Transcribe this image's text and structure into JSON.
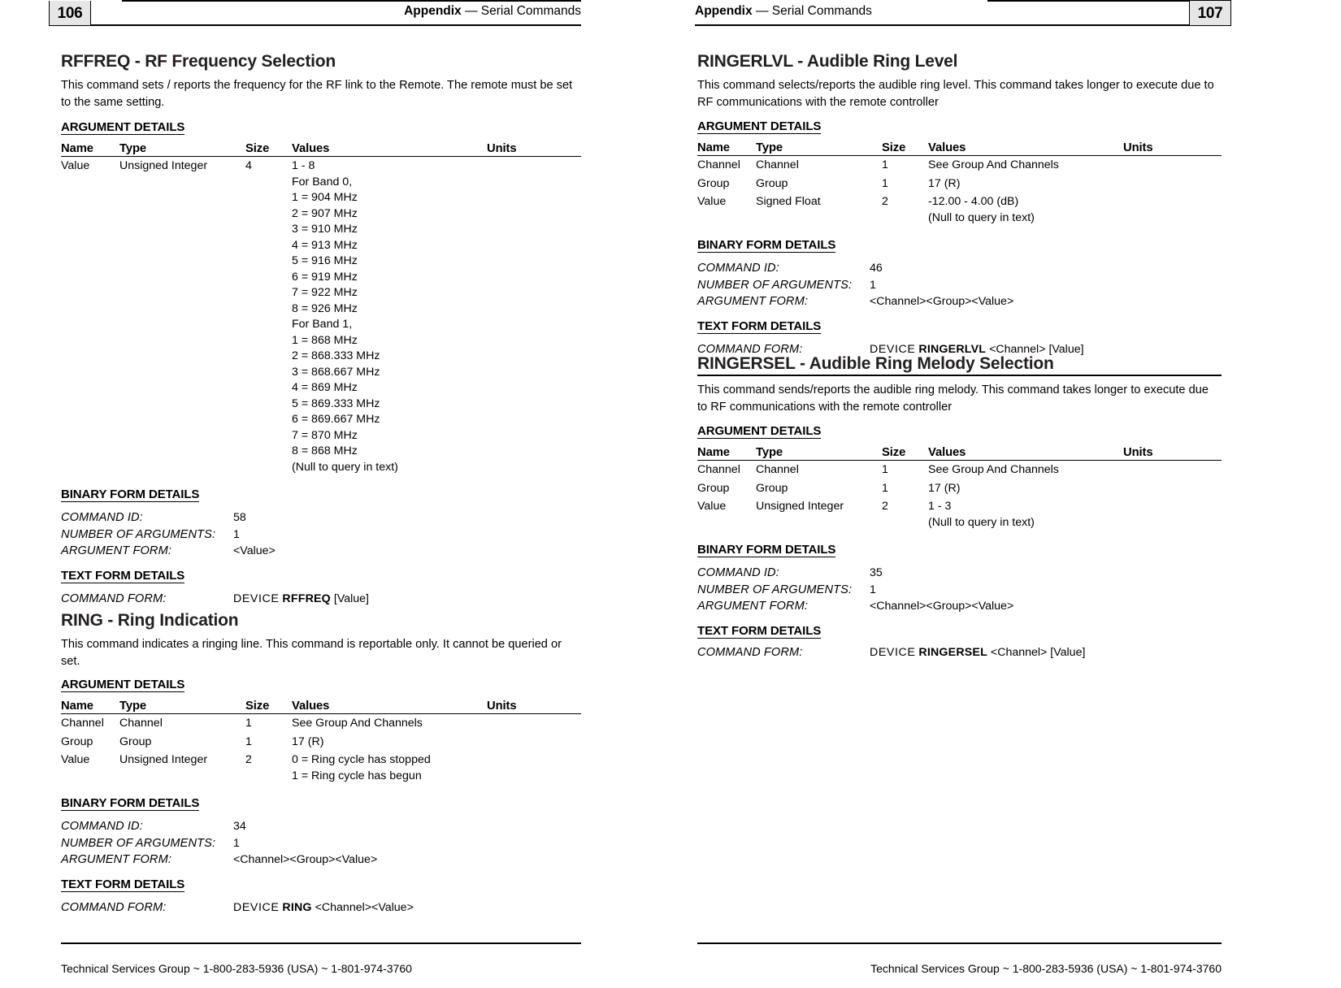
{
  "spread": {
    "left_page": {
      "page_number": "106",
      "header_title_bold": "Appendix",
      "header_title_rest": "— Serial Commands",
      "footer": "Technical Services Group ~ 1-800-283-5936 (USA) ~ 1-801-974-3760",
      "sections": [
        {
          "heading": "RFFREQ - RF Frequency Selection",
          "description": "This command sets / reports the frequency for the RF link to the Remote. The remote must be set to the same setting.",
          "argument_details_label": "ARGUMENT DETAILS",
          "table": {
            "columns": [
              "Name",
              "Type",
              "Size",
              "Values",
              "Units"
            ],
            "rows": [
              {
                "name": "Value",
                "type": "Unsigned Integer",
                "size": "4",
                "values": [
                  "1 - 8",
                  "For Band 0,",
                  "1 = 904 MHz",
                  "2 = 907 MHz",
                  "3 = 910 MHz",
                  "4 = 913 MHz",
                  "5 = 916 MHz",
                  "6 = 919 MHz",
                  "7 = 922 MHz",
                  "8 = 926 MHz",
                  "For Band 1,",
                  "1 = 868 MHz",
                  "2 = 868.333 MHz",
                  "3 = 868.667 MHz",
                  "4 = 869 MHz",
                  "5 = 869.333 MHz",
                  "6 = 869.667 MHz",
                  "7 = 870 MHz",
                  "8 = 868 MHz",
                  "(Null to query in text)"
                ],
                "units": ""
              }
            ]
          },
          "binary_form_label": "BINARY FORM DETAILS",
          "binary_form": [
            {
              "key": "COMMAND ID:",
              "value": "58"
            },
            {
              "key": "NUMBER OF ARGUMENTS:",
              "value": "1"
            },
            {
              "key": "ARGUMENT FORM:",
              "value": "<Value>"
            }
          ],
          "text_form_label": "TEXT FORM DETAILS",
          "text_form": {
            "key": "COMMAND FORM:",
            "device": "DEVICE",
            "command": "RFFREQ",
            "args": "[Value]"
          }
        },
        {
          "heading": "RING - Ring Indication",
          "description": "This command indicates a ringing line. This command is reportable only.  It cannot be queried or set.",
          "argument_details_label": "ARGUMENT DETAILS",
          "table": {
            "columns": [
              "Name",
              "Type",
              "Size",
              "Values",
              "Units"
            ],
            "rows": [
              {
                "name": "Channel",
                "type": "Channel",
                "size": "1",
                "values": [
                  "See Group And Channels"
                ],
                "units": ""
              },
              {
                "name": "Group",
                "type": "Group",
                "size": "1",
                "values": [
                  "17 (R)"
                ],
                "units": ""
              },
              {
                "name": "Value",
                "type": "Unsigned Integer",
                "size": "2",
                "values": [
                  "0 = Ring cycle has stopped",
                  "1 = Ring cycle has begun"
                ],
                "units": ""
              }
            ]
          },
          "binary_form_label": "BINARY FORM DETAILS",
          "binary_form": [
            {
              "key": "COMMAND ID:",
              "value": "34"
            },
            {
              "key": "NUMBER OF ARGUMENTS:",
              "value": "1"
            },
            {
              "key": "ARGUMENT FORM:",
              "value": "<Channel><Group><Value>"
            }
          ],
          "text_form_label": "TEXT FORM DETAILS",
          "text_form": {
            "key": "COMMAND FORM:",
            "device": "DEVICE",
            "command": "RING",
            "args": "<Channel><Value>"
          }
        }
      ]
    },
    "right_page": {
      "page_number": "107",
      "header_title_bold": "Appendix",
      "header_title_rest": "— Serial Commands",
      "footer": "Technical Services Group ~ 1-800-283-5936 (USA) ~ 1-801-974-3760",
      "sections": [
        {
          "heading": "RINGERLVL - Audible Ring Level",
          "description": "This command selects/reports the audible ring level. This command takes longer to execute due to RF communications with the remote controller",
          "argument_details_label": "ARGUMENT DETAILS",
          "table": {
            "columns": [
              "Name",
              "Type",
              "Size",
              "Values",
              "Units"
            ],
            "rows": [
              {
                "name": "Channel",
                "type": "Channel",
                "size": "1",
                "values": [
                  "See Group And Channels"
                ],
                "units": ""
              },
              {
                "name": "Group",
                "type": "Group",
                "size": "1",
                "values": [
                  "17 (R)"
                ],
                "units": ""
              },
              {
                "name": "Value",
                "type": "Signed Float",
                "size": "2",
                "values": [
                  "-12.00 - 4.00 (dB)",
                  "(Null to query in text)"
                ],
                "units": ""
              }
            ]
          },
          "binary_form_label": "BINARY FORM DETAILS",
          "binary_form": [
            {
              "key": "COMMAND ID:",
              "value": "46"
            },
            {
              "key": "NUMBER OF ARGUMENTS:",
              "value": "1"
            },
            {
              "key": "ARGUMENT FORM:",
              "value": "<Channel><Group><Value>"
            }
          ],
          "text_form_label": "TEXT FORM DETAILS",
          "text_form": {
            "key": "COMMAND FORM:",
            "device": "DEVICE",
            "command": "RINGERLVL",
            "args": "<Channel> [Value]"
          }
        },
        {
          "heading": "RINGERSEL - Audible Ring Melody Selection",
          "description": "This command sends/reports the audible ring melody. This command takes longer to execute due to RF communications with the remote controller",
          "argument_details_label": "ARGUMENT DETAILS",
          "table": {
            "columns": [
              "Name",
              "Type",
              "Size",
              "Values",
              "Units"
            ],
            "rows": [
              {
                "name": "Channel",
                "type": "Channel",
                "size": "1",
                "values": [
                  "See Group And Channels"
                ],
                "units": ""
              },
              {
                "name": "Group",
                "type": "Group",
                "size": "1",
                "values": [
                  "17 (R)"
                ],
                "units": ""
              },
              {
                "name": "Value",
                "type": "Unsigned Integer",
                "size": "2",
                "values": [
                  "1 - 3",
                  "(Null to query in text)"
                ],
                "units": ""
              }
            ]
          },
          "binary_form_label": "BINARY FORM DETAILS",
          "binary_form": [
            {
              "key": "COMMAND ID:",
              "value": "35"
            },
            {
              "key": "NUMBER OF ARGUMENTS:",
              "value": "1"
            },
            {
              "key": "ARGUMENT FORM:",
              "value": "<Channel><Group><Value>"
            }
          ],
          "text_form_label": "TEXT FORM DETAILS",
          "text_form": {
            "key": "COMMAND FORM:",
            "device": "DEVICE",
            "command": "RINGERSEL",
            "args": "<Channel> [Value]"
          }
        }
      ]
    }
  }
}
